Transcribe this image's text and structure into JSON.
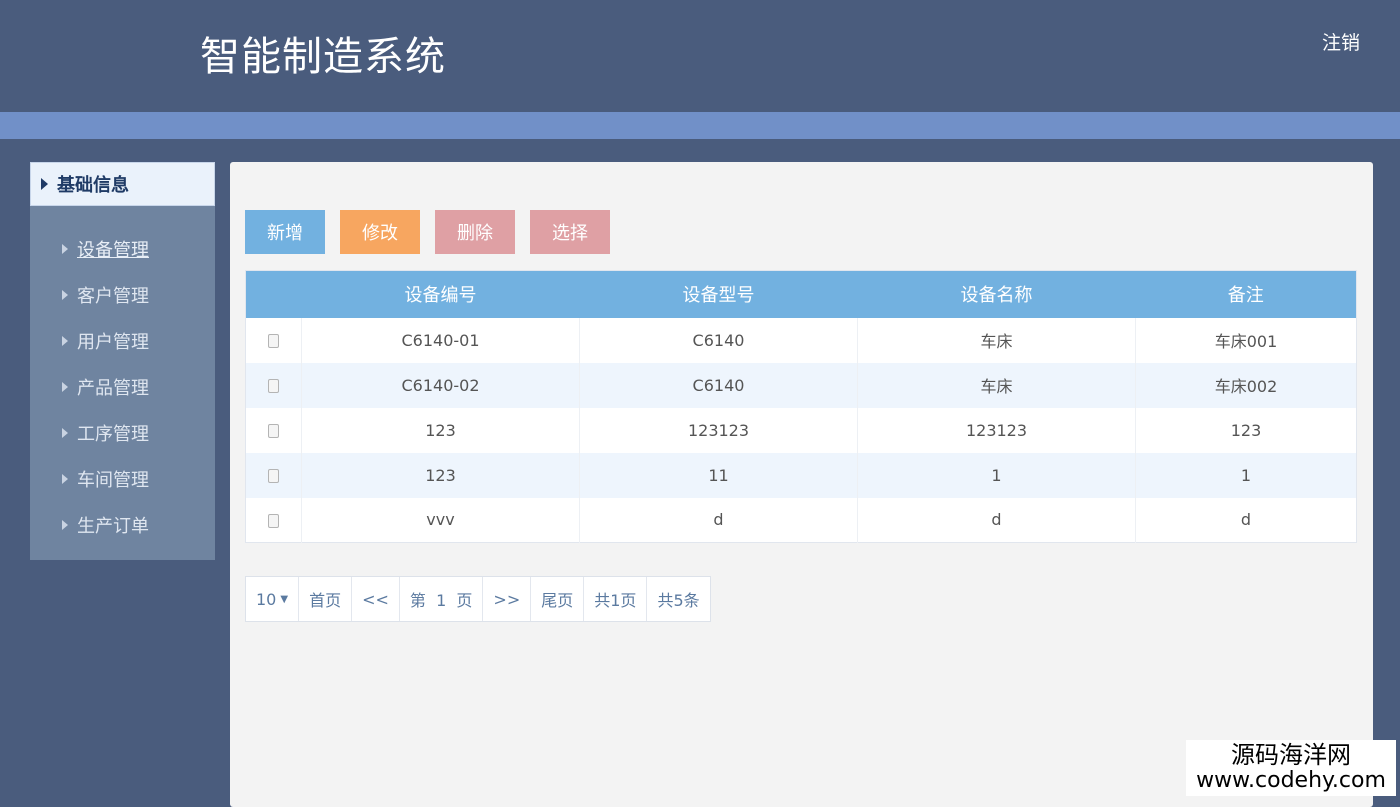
{
  "header": {
    "title": "智能制造系统",
    "logout_label": "注销"
  },
  "sidebar": {
    "section_label": "基础信息",
    "items": [
      {
        "label": "设备管理",
        "active": true
      },
      {
        "label": "客户管理"
      },
      {
        "label": "用户管理"
      },
      {
        "label": "产品管理"
      },
      {
        "label": "工序管理"
      },
      {
        "label": "车间管理"
      },
      {
        "label": "生产订单"
      }
    ]
  },
  "toolbar": {
    "add_label": "新增",
    "edit_label": "修改",
    "delete_label": "删除",
    "select_label": "选择"
  },
  "table": {
    "columns": [
      "设备编号",
      "设备型号",
      "设备名称",
      "备注"
    ],
    "rows": [
      [
        "C6140-01",
        "C6140",
        "车床",
        "车床001"
      ],
      [
        "C6140-02",
        "C6140",
        "车床",
        "车床002"
      ],
      [
        "123",
        "123123",
        "123123",
        "123"
      ],
      [
        "123",
        "11",
        "1",
        "1"
      ],
      [
        "vvv",
        "d",
        "d",
        "d"
      ]
    ]
  },
  "pagination": {
    "page_size": "10",
    "first": "首页",
    "prev": "<<",
    "current": "第  1  页",
    "next": ">>",
    "last": "尾页",
    "total_pages": "共1页",
    "total_items": "共5条"
  },
  "watermark": {
    "name": "源码海洋网",
    "url": "www.codehy.com"
  },
  "colors": {
    "header_bg": "#4a5c7d",
    "accent_bar": "#7190c8",
    "primary": "#72b1e0",
    "warning": "#f7a660",
    "danger": "#dfa0a4"
  }
}
